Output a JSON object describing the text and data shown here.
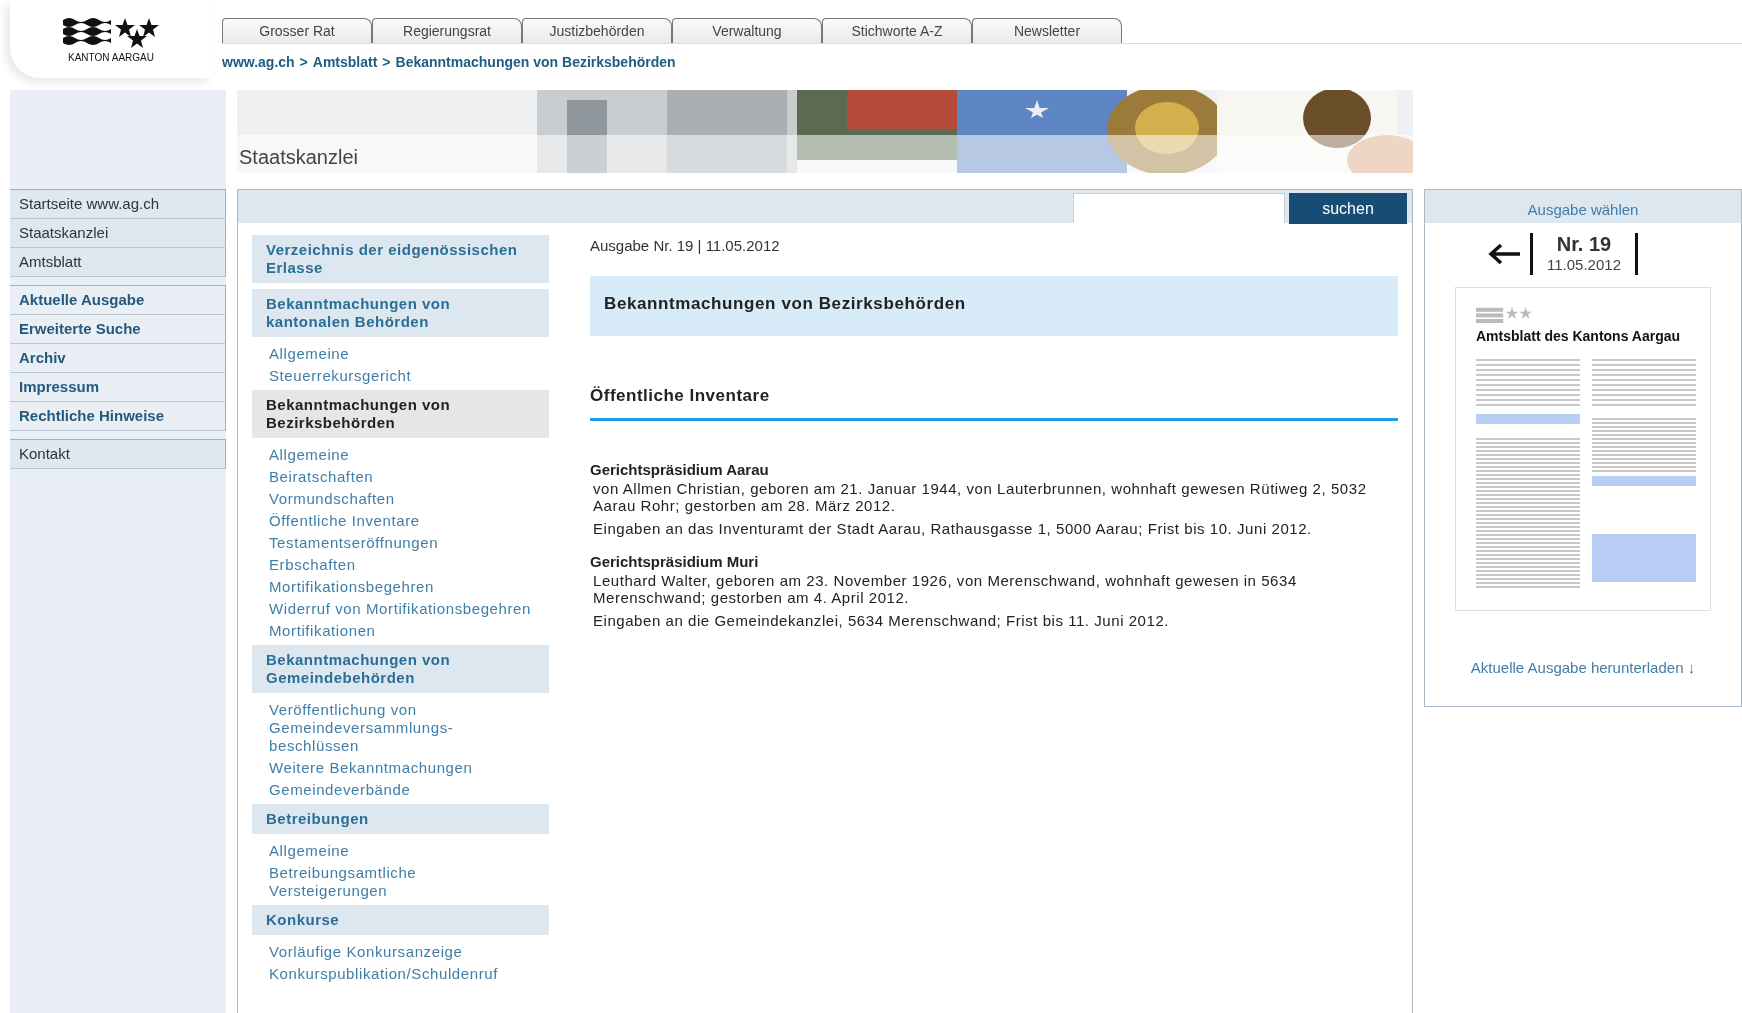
{
  "logo": {
    "text": "KANTON AARGAU"
  },
  "tabs": [
    {
      "label": "Grosser Rat"
    },
    {
      "label": "Regierungsrat"
    },
    {
      "label": "Justizbehörden"
    },
    {
      "label": "Verwaltung"
    },
    {
      "label": "Stichworte A-Z"
    },
    {
      "label": "Newsletter"
    }
  ],
  "breadcrumb": {
    "separator": ">",
    "items": [
      "www.ag.ch",
      "Amtsblatt",
      "Bekanntmachungen von Bezirksbehörden"
    ]
  },
  "banner": {
    "title": "Staatskanzlei"
  },
  "sidebar": {
    "groups": [
      {
        "kind": "plain",
        "items": [
          "Startseite www.ag.ch",
          "Staatskanzlei",
          "Amtsblatt"
        ]
      },
      {
        "kind": "strong",
        "items": [
          "Aktuelle Ausgabe",
          "Erweiterte Suche",
          "Archiv",
          "Impressum",
          "Rechtliche Hinweise"
        ]
      },
      {
        "kind": "plain",
        "items": [
          "Kontakt"
        ]
      }
    ]
  },
  "search": {
    "button": "suchen"
  },
  "subnav": [
    {
      "heading": "Verzeichnis der eidgenössischen Erlasse",
      "selected": false
    },
    {
      "heading": "Bekanntmachungen von kantonalen Behörden",
      "selected": false,
      "items": [
        "Allgemeine",
        "Steuerrekursgericht"
      ]
    },
    {
      "heading": "Bekanntmachungen von Bezirksbehörden",
      "selected": true,
      "items": [
        "Allgemeine",
        "Beiratschaften",
        "Vormundschaften",
        "Öffentliche Inventare",
        "Testamentseröffnungen",
        "Erbschaften",
        "Mortifikationsbegehren",
        "Widerruf von Mortifikationsbegehren",
        "Mortifikationen"
      ]
    },
    {
      "heading": "Bekanntmachungen von Gemeindebehörden",
      "selected": false,
      "items": [
        "Veröffentlichung von Gemeindeversammlungs-beschlüssen",
        "Weitere Bekanntmachungen",
        "Gemeindeverbände"
      ]
    },
    {
      "heading": "Betreibungen",
      "selected": false,
      "items": [
        "Allgemeine",
        "Betreibungsamtliche Versteigerungen"
      ]
    },
    {
      "heading": "Konkurse",
      "selected": false,
      "items": [
        "Vorläufige Konkursanzeige",
        "Konkurspublikation/Schuldenruf"
      ]
    }
  ],
  "content": {
    "issue": "Ausgabe Nr. 19 | 11.05.2012",
    "section_title": "Bekanntmachungen von Bezirksbehörden",
    "subsection_title": "Öffentliche Inventare",
    "entries": [
      {
        "court": "Gerichtspräsidium Aarau",
        "person": "von Allmen Christian, geboren am 21. Januar 1944, von Lauterbrunnen, wohnhaft gewesen Rütiweg 2, 5032 Aarau Rohr; gestorben am 28. März 2012.",
        "instructions": "Eingaben an das Inventuramt der Stadt Aarau, Rathausgasse 1, 5000 Aarau; Frist bis 10. Juni 2012."
      },
      {
        "court": "Gerichtspräsidium Muri",
        "person": "Leuthard Walter, geboren am 23. November 1926, von Merenschwand, wohnhaft gewesen in 5634 Merenschwand; gestorben am 4. April 2012.",
        "instructions": "Eingaben an die Gemeindekanzlei, 5634 Merenschwand; Frist bis 11. Juni 2012."
      }
    ]
  },
  "issue_panel": {
    "title": "Ausgabe wählen",
    "number": "Nr. 19",
    "date": "11.05.2012",
    "cover_title": "Amtsblatt des Kantons Aargau",
    "download": "Aktuelle Ausgabe herunterladen ↓"
  }
}
